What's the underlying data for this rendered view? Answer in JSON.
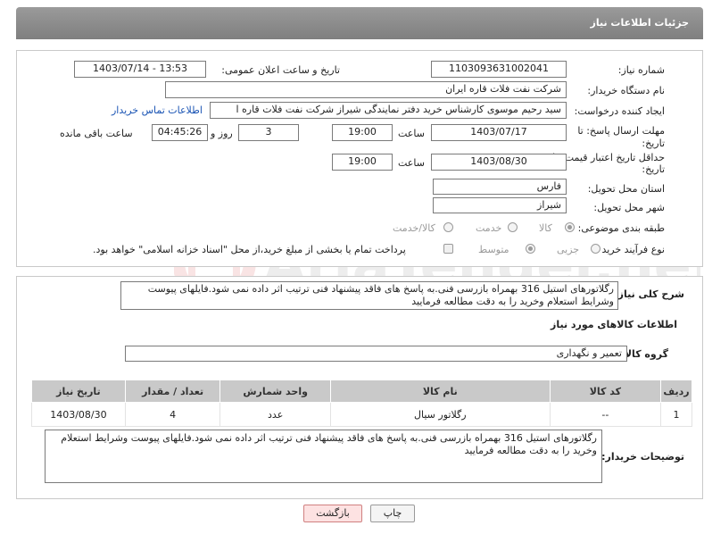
{
  "header": {
    "title": "جزئیات اطلاعات نیاز"
  },
  "form": {
    "need_number": {
      "label": "شماره نیاز:",
      "value": "1103093631002041"
    },
    "announce": {
      "label": "تاریخ و ساعت اعلان عمومی:",
      "value": "1403/07/14 - 13:53"
    },
    "buyer_org": {
      "label": "نام دستگاه خریدار:",
      "value": "شرکت نفت فلات قاره ایران"
    },
    "creator": {
      "label": "ایجاد کننده درخواست:",
      "value": "سید رحیم موسوی کارشناس خرید دفتر نمایندگی شیراز شرکت نفت فلات قاره ا",
      "contact_link": "اطلاعات تماس خریدار"
    },
    "reply_deadline": {
      "label": "مهلت ارسال پاسخ: تا",
      "label2": "تاریخ:",
      "date": "1403/07/17",
      "time_label": "ساعت",
      "time": "19:00",
      "days": "3",
      "days_label": "روز و",
      "remaining": "04:45:26",
      "remaining_label": "ساعت باقی مانده"
    },
    "validity": {
      "label": "حداقل تاریخ اعتبار قیمت: تا",
      "label2": "تاریخ:",
      "date": "1403/08/30",
      "time_label": "ساعت",
      "time": "19:00"
    },
    "province": {
      "label": "استان محل تحویل:",
      "value": "فارس"
    },
    "city": {
      "label": "شهر محل تحویل:",
      "value": "شیراز"
    },
    "category": {
      "label": "طبقه بندی موضوعی:",
      "options": [
        "کالا",
        "خدمت",
        "کالا/خدمت"
      ],
      "selected": "کالا"
    },
    "process": {
      "label": "نوع فرآیند خرید :",
      "options": [
        "جزیی",
        "متوسط"
      ],
      "selected": "متوسط",
      "payment_note": "پرداخت تمام یا بخشی از مبلغ خرید،از محل \"اسناد خزانه اسلامی\" خواهد بود."
    }
  },
  "description": {
    "label": "شرح کلی نیاز:",
    "text": "رگلاتورهای استیل 316 بهمراه بازرسی فنی.به پاسخ های فاقد پیشنهاد فنی ترتیب اثر داده نمی شود.فایلهای پیوست وشرایط استعلام وخرید را به دقت مطالعه فرمایید"
  },
  "goods": {
    "section_title": "اطلاعات کالاهای مورد نیاز",
    "group_label": "گروه کالا:",
    "group_value": "تعمیر و نگهداری",
    "columns": [
      "ردیف",
      "کد کالا",
      "نام کالا",
      "واحد شمارش",
      "تعداد / مقدار",
      "تاریخ نیاز"
    ],
    "rows": [
      {
        "row": "1",
        "code": "--",
        "name": "رگلاتور سیال",
        "unit": "عدد",
        "qty": "4",
        "date": "1403/08/30"
      }
    ]
  },
  "buyer_notes": {
    "label": "توضیحات خریدار:",
    "text": "رگلاتورهای استیل 316 بهمراه بازرسی فنی.به پاسخ های فاقد پیشنهاد فنی ترتیب اثر داده نمی شود.فایلهای پیوست وشرایط استعلام وخرید را به دقت مطالعه فرمایید"
  },
  "buttons": {
    "print": "چاپ",
    "back": "بازگشت"
  },
  "watermark": "AriaTender.net",
  "colors": {
    "header": "#8a8a8a",
    "link": "#1a54b4",
    "back_button_bg": "#fde2e2",
    "back_button_border": "#d08080"
  }
}
